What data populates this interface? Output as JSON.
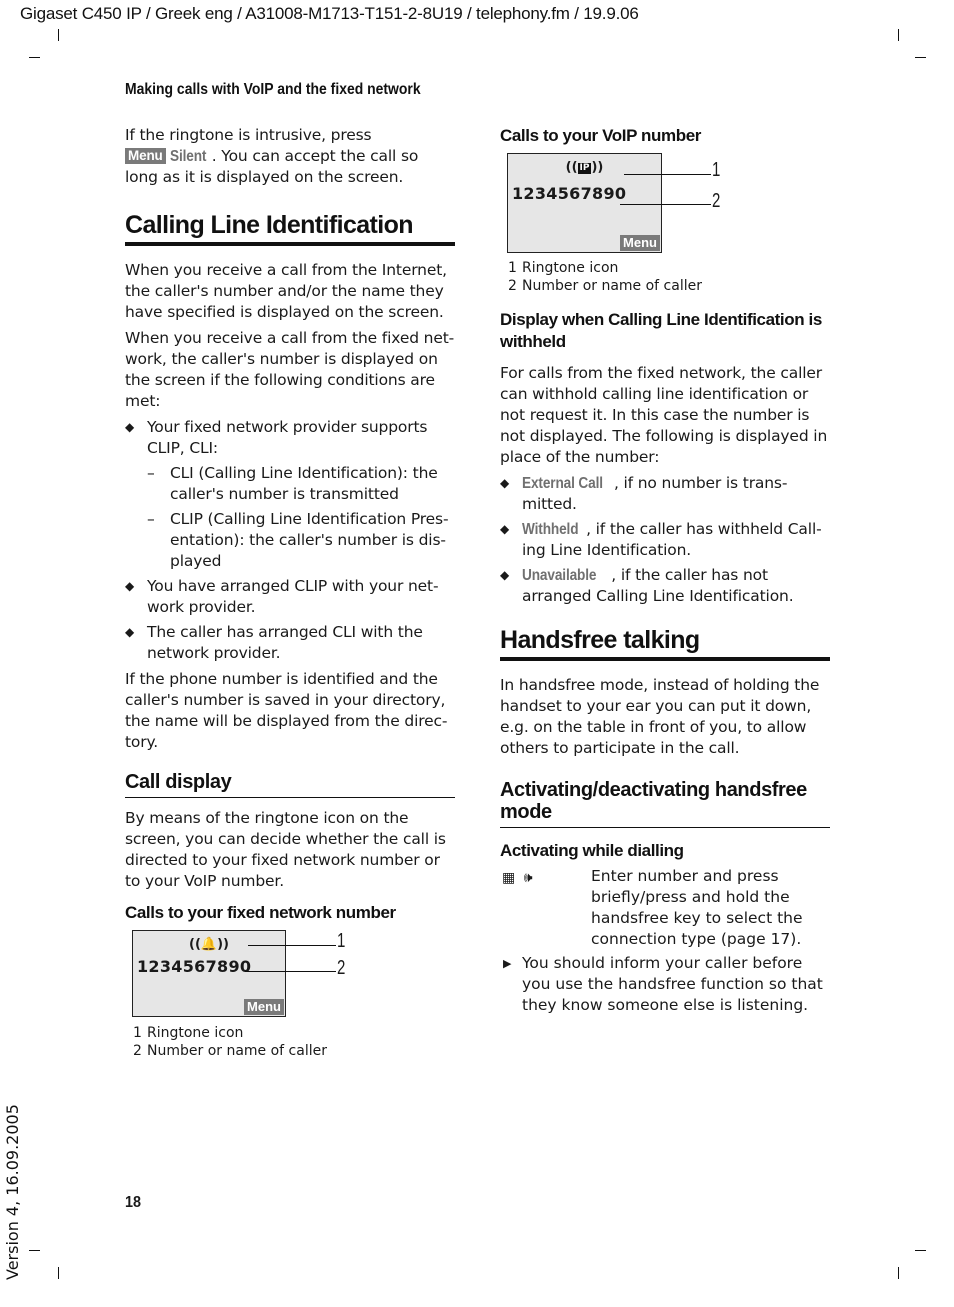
{
  "doc_meta": "Gigaset C450 IP / Greek eng / A31008-M1713-T151-2-8U19 / telephony.fm / 19.9.06",
  "running_head": "Making calls with VoIP and the fixed network",
  "page_number": "18",
  "version": "Version 4, 16.09.2005",
  "left": {
    "intro": {
      "pre": "If the ringtone is intrusive, press",
      "menu_key": "Menu",
      "softkey": "Silent",
      "post": ". You can accept the call so long as it is displayed on the screen."
    },
    "clip_heading": "Calling Line Identification",
    "clip_p1": "When you receive a call from the Internet, the caller's number and/or the name they have specified is displayed on the screen.",
    "clip_p2": "When you receive a call from the fixed net-work, the caller's number is displayed on the screen if the following conditions are met:",
    "conditions": [
      {
        "text": "Your fixed network provider supports CLIP, CLI:",
        "sub": [
          "CLI (Calling Line Identification): the caller's number is transmitted",
          "CLIP (Calling Line Identification Pres-entation): the caller's number is dis-played"
        ]
      },
      {
        "text": "You have arranged CLIP with your net-work provider."
      },
      {
        "text": "The caller has arranged CLI with the network provider."
      }
    ],
    "bullet_glyph": "◆",
    "dash_glyph": "–",
    "clip_p3": "If the phone number is identified and the caller's number is saved in your directory, the name will be displayed from the direc-tory.",
    "call_display_heading": "Call display",
    "call_display_p": "By means of the ringtone icon on the screen, you can decide whether the call is directed to your fixed network number or to your VoIP number.",
    "fixed_heading": "Calls to your fixed network number",
    "fixed_display": {
      "ring_icon": "((⭕))",
      "ring_icon_name": "bell-ringtone-icon",
      "number": "1234567890",
      "menu": "Menu",
      "callouts": [
        "1",
        "2"
      ],
      "legend": [
        {
          "n": "1",
          "text": "Ringtone icon"
        },
        {
          "n": "2",
          "text": "Number or name of caller"
        }
      ]
    }
  },
  "right": {
    "voip_heading": "Calls to your VoIP number",
    "voip_display": {
      "ring_open": "((",
      "ring_ip": "IP",
      "ring_close": "))",
      "ring_icon_name": "ip-ringtone-icon",
      "number": "1234567890",
      "menu": "Menu",
      "callouts": [
        "1",
        "2"
      ],
      "legend": [
        {
          "n": "1",
          "text": "Ringtone icon"
        },
        {
          "n": "2",
          "text": "Number or name of caller"
        }
      ]
    },
    "withheld_heading": "Display when Calling Line Identification is withheld",
    "withheld_p": "For calls from the fixed network, the caller can withhold calling line identification or not request it. In this case the number is not displayed. The following is displayed in place of the number:",
    "withheld_items": [
      {
        "softkey": "External Call",
        "text": ", if no number is trans-mitted."
      },
      {
        "softkey": "Withheld",
        "text": ", if the caller has withheld Call-ing Line Identification."
      },
      {
        "softkey": "Unavailable",
        "text": " , if the caller has not arranged Calling Line Identification."
      }
    ],
    "handsfree_heading": "Handsfree talking",
    "handsfree_p": "In handsfree mode, instead of holding the handset to your ear you can put it down, e.g. on the table in front of you, to allow others to participate in the call.",
    "activate_heading": "Activating/deactivating handsfree mode",
    "dialling_heading": "Activating while dialling",
    "dialling_keys": {
      "keypad": "▦",
      "handsfree": "🕪"
    },
    "dialling_text": "Enter number and press briefly/press and hold the handsfree key to select the connection type (page 17).",
    "arrow_glyph": "▶",
    "note": "You should inform your caller before you use the handsfree function so that they know someone else is listening."
  }
}
